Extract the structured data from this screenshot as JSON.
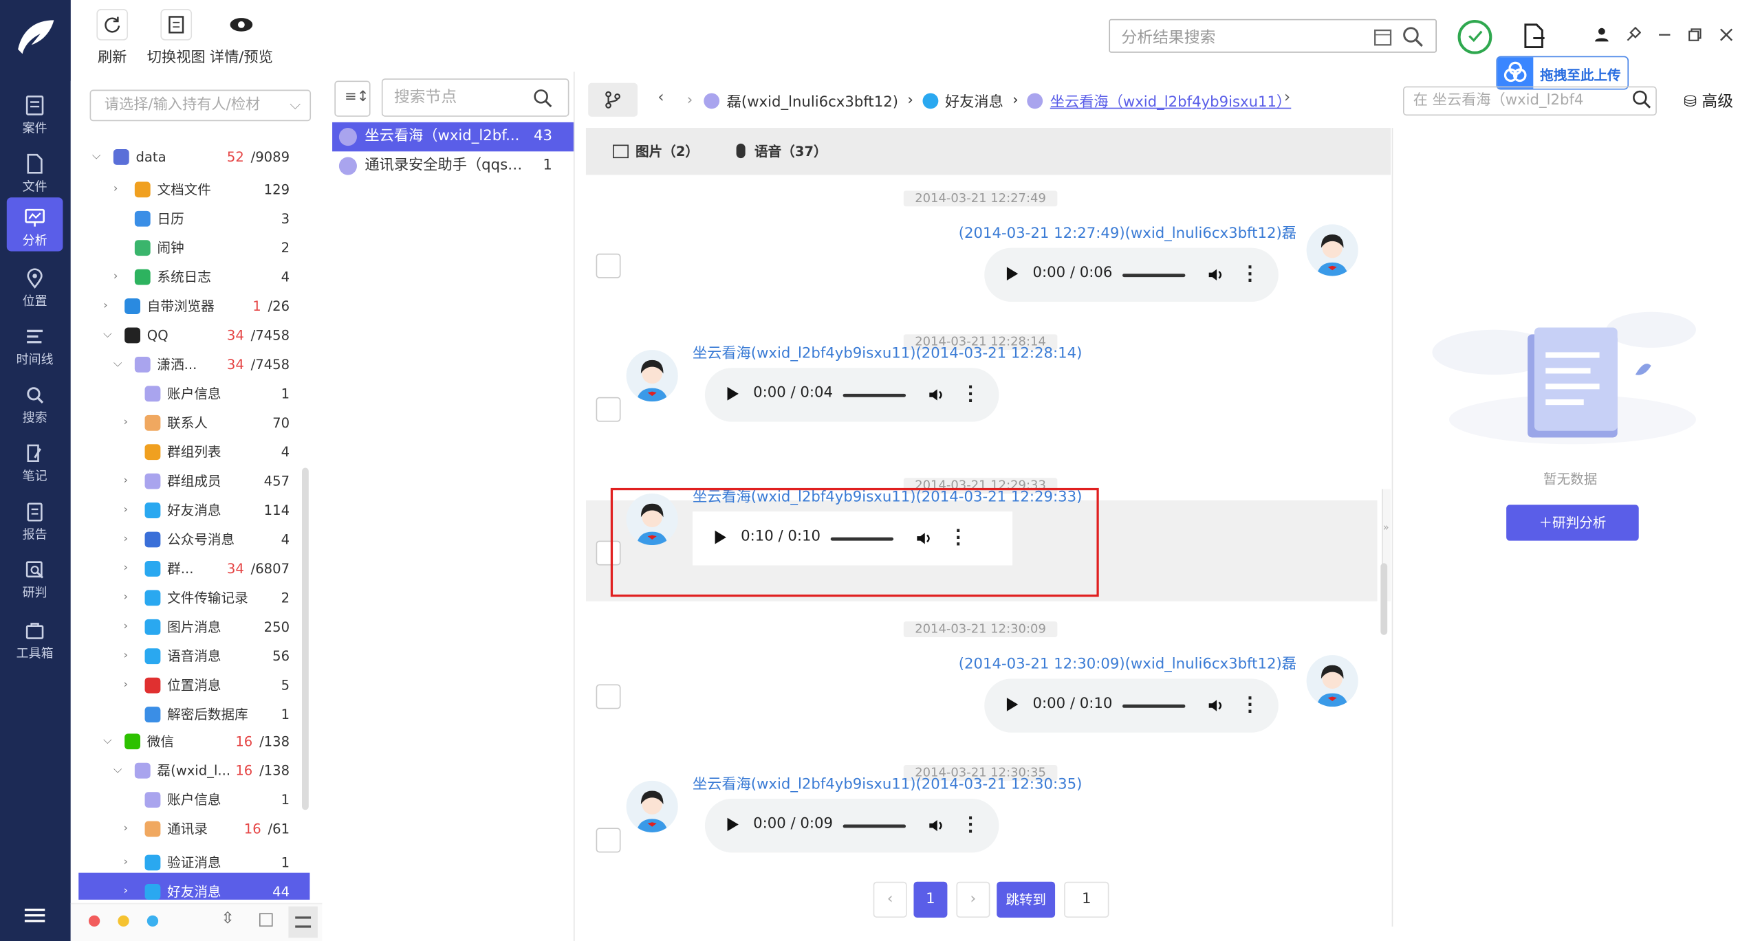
{
  "toolbar": {
    "refresh": "刷新",
    "switch_view": "切换视图",
    "detail_preview": "详情/预览",
    "search_placeholder": "分析结果搜索",
    "upload_badge": "拖拽至此上传"
  },
  "nav": {
    "items": [
      {
        "label": "案件",
        "icon": "case-icon"
      },
      {
        "label": "文件",
        "icon": "file-icon"
      },
      {
        "label": "分析",
        "icon": "analysis-icon"
      },
      {
        "label": "位置",
        "icon": "location-icon"
      },
      {
        "label": "时间线",
        "icon": "timeline-icon"
      },
      {
        "label": "搜索",
        "icon": "search-icon"
      },
      {
        "label": "笔记",
        "icon": "note-icon"
      },
      {
        "label": "报告",
        "icon": "report-icon"
      },
      {
        "label": "研判",
        "icon": "judge-icon"
      },
      {
        "label": "工具箱",
        "icon": "toolbox-icon"
      }
    ],
    "active": "分析"
  },
  "tree": {
    "placeholder": "请选择/输入持有人/检材",
    "rows": [
      {
        "label": "data",
        "red": "52",
        "count": "/9089",
        "color": "#5a6fd8"
      },
      {
        "label": "文档文件",
        "count": "129",
        "color": "#f0a020"
      },
      {
        "label": "日历",
        "count": "3",
        "color": "#3a8ee6"
      },
      {
        "label": "闹钟",
        "count": "2",
        "color": "#3ab56c"
      },
      {
        "label": "系统日志",
        "count": "4",
        "color": "#2db35f"
      },
      {
        "label": "自带浏览器",
        "red": "1",
        "count": "/26",
        "color": "#2a8ae0"
      },
      {
        "label": "QQ",
        "red": "34",
        "count": "/7458",
        "color": "#222222"
      },
      {
        "label": "潇洒...",
        "red": "34",
        "count": "/7458",
        "color": "#a9a4ee"
      },
      {
        "label": "账户信息",
        "count": "1",
        "color": "#a9a4ee"
      },
      {
        "label": "联系人",
        "count": "70",
        "color": "#f0a860"
      },
      {
        "label": "群组列表",
        "count": "4",
        "color": "#f0a020"
      },
      {
        "label": "群组成员",
        "count": "457",
        "color": "#a9a4ee"
      },
      {
        "label": "好友消息",
        "count": "114",
        "color": "#2aa8f0"
      },
      {
        "label": "公众号消息",
        "count": "4",
        "color": "#3a6fd8"
      },
      {
        "label": "群...",
        "red": "34",
        "count": "/6807",
        "color": "#2aa8f0"
      },
      {
        "label": "文件传输记录",
        "count": "2",
        "color": "#2aa8f0"
      },
      {
        "label": "图片消息",
        "count": "250",
        "color": "#2aa8f0"
      },
      {
        "label": "语音消息",
        "count": "56",
        "color": "#2aa8f0"
      },
      {
        "label": "位置消息",
        "count": "5",
        "color": "#e03030"
      },
      {
        "label": "解密后数据库",
        "count": "1",
        "color": "#3a8ee6"
      },
      {
        "label": "微信",
        "red": "16",
        "count": "/138",
        "color": "#2dc100"
      },
      {
        "label": "磊(wxid_l...",
        "red": "16",
        "count": "/138",
        "color": "#a9a4ee"
      },
      {
        "label": "账户信息",
        "count": "1",
        "color": "#a9a4ee"
      },
      {
        "label": "通讯录",
        "red": "16",
        "count": "/61",
        "color": "#f0a860"
      },
      {
        "label": "验证消息",
        "count": "1",
        "color": "#2aa8f0"
      },
      {
        "label": "好友消息",
        "count": "44",
        "color": "#2aa8f0"
      }
    ]
  },
  "nodes": {
    "search_placeholder": "搜索节点",
    "items": [
      {
        "name": "坐云看海（wxid_l2bf...",
        "count": "43"
      },
      {
        "name": "通讯录安全助手（qqsy...",
        "count": "1"
      }
    ]
  },
  "breadcrumb": {
    "items": [
      "磊(wxid_lnuli6cx3bft12)",
      "好友消息",
      "坐云看海（wxid_l2bf4yb9isxu11）"
    ],
    "search_placeholder": "在 坐云看海（wxid_l2bf4",
    "advanced": "高级"
  },
  "tabs": {
    "images": "图片（2）",
    "voice": "语音（37）"
  },
  "messages": [
    {
      "time": "2014-03-21 12:27:49",
      "header": "(2014-03-21 12:27:49)(wxid_lnuli6cx3bft12)磊",
      "audio": "0:00 / 0:06",
      "side": "right"
    },
    {
      "time": "2014-03-21 12:28:14",
      "header": "坐云看海(wxid_l2bf4yb9isxu11)(2014-03-21 12:28:14)",
      "audio": "0:00 / 0:04",
      "side": "left"
    },
    {
      "time": "2014-03-21 12:29:33",
      "header": "坐云看海(wxid_l2bf4yb9isxu11)(2014-03-21 12:29:33)",
      "audio": "0:10 / 0:10",
      "side": "left"
    },
    {
      "time": "2014-03-21 12:30:09",
      "header": "(2014-03-21 12:30:09)(wxid_lnuli6cx3bft12)磊",
      "audio": "0:00 / 0:10",
      "side": "right"
    },
    {
      "time": "2014-03-21 12:30:35",
      "header": "坐云看海(wxid_l2bf4yb9isxu11)(2014-03-21 12:30:35)",
      "audio": "0:00 / 0:09",
      "side": "left"
    }
  ],
  "pagination": {
    "current": "1",
    "jump_label": "跳转到",
    "jump_value": "1"
  },
  "right_panel": {
    "empty_text": "暂无数据",
    "button": "研判分析"
  },
  "colors": {
    "nav_bg": "#1c2a55",
    "accent": "#5a5ee8",
    "link": "#3a7bd5",
    "highlight_border": "#e02020"
  }
}
